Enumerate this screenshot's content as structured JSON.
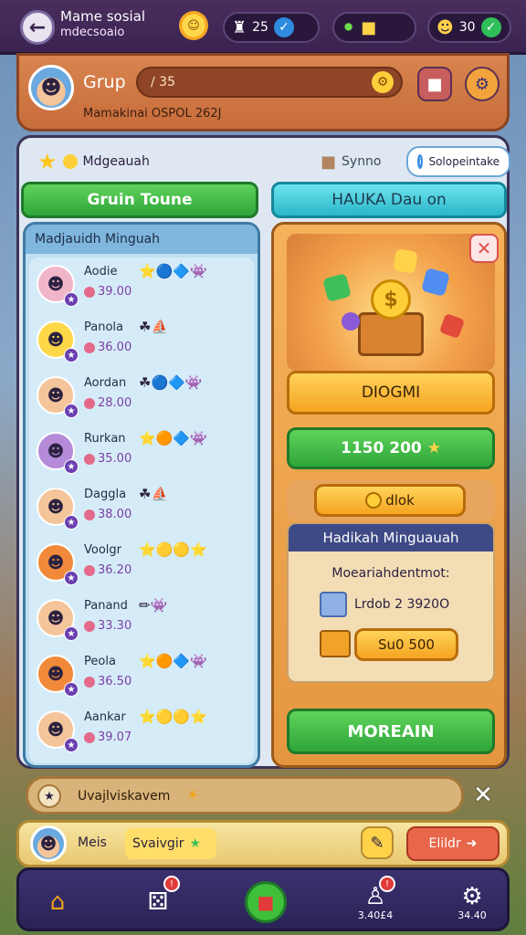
{
  "header": {
    "title": "Mame sosial",
    "subtitle": "mdecsoaio",
    "pill1_value": "25",
    "pill2_value": "30"
  },
  "profile": {
    "name": "Grup",
    "name_value": "∕ 35",
    "caption": "Mamakinai OSPOL 262J"
  },
  "toolbar": {
    "weekly_label": "Mdgeauah",
    "chip2_label": "Synno",
    "chip3_label": "Solopeintake"
  },
  "tabs": {
    "left": "Gruin Toune",
    "right": "HAUKA Dau on"
  },
  "leaderboard": {
    "title": "Madjauidh Minguah",
    "rows": [
      {
        "name": "Aodie",
        "score": "39.00",
        "avatar_bg": "#f0b5c8",
        "icons": "⭐🔵🔷👾"
      },
      {
        "name": "Panola",
        "score": "36.00",
        "avatar_bg": "#ffd84a",
        "icons": "☘⛵"
      },
      {
        "name": "Aordan",
        "score": "28.00",
        "avatar_bg": "#f4c59a",
        "icons": "☘🔵🔷👾"
      },
      {
        "name": "Rurkan",
        "score": "35.00",
        "avatar_bg": "#b58ad9",
        "icons": "⭐🟠🔷👾"
      },
      {
        "name": "Daggla",
        "score": "38.00",
        "avatar_bg": "#f4c59a",
        "icons": "☘⛵"
      },
      {
        "name": "Voolgr",
        "score": "36.20",
        "avatar_bg": "#f08a3a",
        "icons": "⭐🟡🟡⭐"
      },
      {
        "name": "Panand",
        "score": "33.30",
        "avatar_bg": "#f4c59a",
        "icons": "✏👾"
      },
      {
        "name": "Peola",
        "score": "36.50",
        "avatar_bg": "#f08a3a",
        "icons": "⭐🟠🔷👾"
      },
      {
        "name": "Aankar",
        "score": "39.07",
        "avatar_bg": "#f4c59a",
        "icons": "⭐🟡🟡⭐"
      }
    ]
  },
  "reward": {
    "primary_button": "DIOGMI",
    "price_button": "1150 200",
    "small_button": "dlok",
    "card_title": "Hadikah Minguauah",
    "card_label": "Moeariahdentmot:",
    "card_value": "Lrdob 2 3920O",
    "card_button": "Su0 500",
    "more_button": "MOREAIN"
  },
  "message": {
    "text": "Uvajlviskavem"
  },
  "footer": {
    "user_label": "Meis",
    "input_value": "Svaivgir",
    "action_button": "Elildr"
  },
  "nav": {
    "item3_value": "3.40£4",
    "item4_value": "34.40"
  },
  "colors": {
    "accent_green": "#2ea53a",
    "accent_teal": "#29b7c9",
    "accent_orange": "#f5a41f",
    "panel_dark": "#3a2350"
  }
}
